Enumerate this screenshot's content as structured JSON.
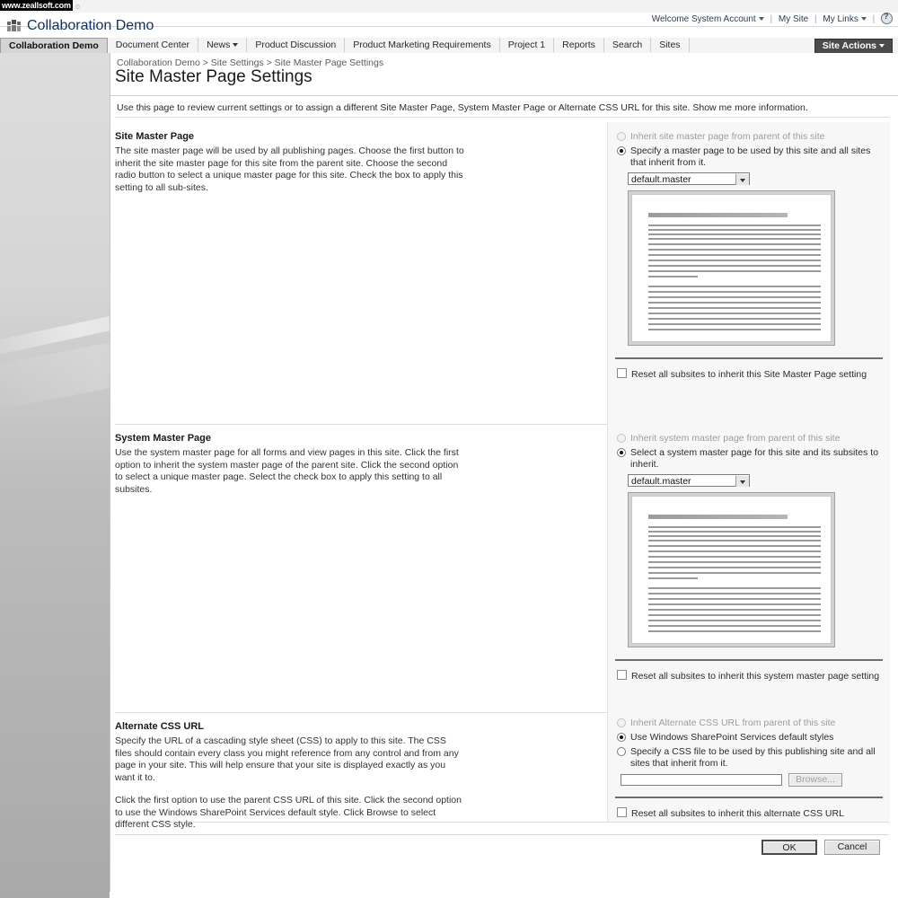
{
  "watermark": {
    "text": "www.zeallsoft.com",
    "shadow": "o"
  },
  "globalbar": {
    "welcome": "Welcome System Account",
    "my_site": "My Site",
    "my_links": "My Links",
    "help_icon": "help-icon",
    "separator": "|"
  },
  "site": {
    "logo_icon": "people-group-icon",
    "title": "Collaboration Demo"
  },
  "tabs": [
    {
      "label": "Collaboration Demo",
      "selected": true,
      "dropdown": false
    },
    {
      "label": "Document Center",
      "selected": false,
      "dropdown": false
    },
    {
      "label": "News",
      "selected": false,
      "dropdown": true
    },
    {
      "label": "Product Discussion",
      "selected": false,
      "dropdown": false
    },
    {
      "label": "Product Marketing Requirements",
      "selected": false,
      "dropdown": false
    },
    {
      "label": "Project 1",
      "selected": false,
      "dropdown": false
    },
    {
      "label": "Reports",
      "selected": false,
      "dropdown": false
    },
    {
      "label": "Search",
      "selected": false,
      "dropdown": false
    },
    {
      "label": "Sites",
      "selected": false,
      "dropdown": false
    }
  ],
  "site_actions": {
    "label": "Site Actions"
  },
  "page": {
    "breadcrumb": "Collaboration Demo > Site Settings > Site Master Page Settings",
    "title": "Site Master Page Settings",
    "description": "Use this page to review current settings or to assign a different Site Master Page, System Master Page or Alternate CSS URL for this site. Show me more information."
  },
  "site_master_page": {
    "heading": "Site Master Page",
    "body": "The site master page will be used by all publishing pages. Choose the first button to inherit the site master page for this site from the parent site. Choose the second radio button to select a unique master page for this site. Check the box to apply this setting to all sub-sites.",
    "option_inherit": "Inherit site master page from parent of this site",
    "option_specify": "Specify a master page to be used by this site and all sites that inherit from it.",
    "selected_master": "default.master",
    "reset_label": "Reset all subsites to inherit this Site Master Page setting",
    "reset_checked": false,
    "inherit_enabled": false,
    "specify_selected": true
  },
  "system_master_page": {
    "heading": "System Master Page",
    "body": "Use the system master page for all forms and view pages in this site. Click the first option to inherit the system master page of the parent site. Click the second option to select a unique master page. Select the check box to apply this setting to all subsites.",
    "option_inherit": "Inherit system master page from parent of this site",
    "option_select": "Select a system master page for this site and its subsites to inherit.",
    "selected_master": "default.master",
    "reset_label": "Reset all subsites to inherit this system master page setting",
    "reset_checked": false,
    "inherit_enabled": false,
    "select_selected": true
  },
  "alternate_css": {
    "heading": "Alternate CSS URL",
    "body_1": "Specify the URL of a cascading style sheet (CSS) to apply to this site. The CSS files should contain every class you might reference from any control and from any page in your site. This will help ensure that your site is displayed exactly as you want it to.",
    "body_2": "Click the first option to use the parent CSS URL of this site. Click the second option to use the Windows SharePoint Services default style. Click Browse to select different CSS style.",
    "option_inherit": "Inherit Alternate CSS URL from parent of this site",
    "option_default": "Use Windows SharePoint Services default styles",
    "option_specify": "Specify a CSS file to be used by this publishing site and all sites that inherit from it.",
    "css_url_value": "",
    "css_url_placeholder": "",
    "browse_label": "Browse...",
    "browse_enabled": false,
    "reset_label": "Reset all subsites to inherit this alternate CSS URL",
    "reset_checked": false,
    "inherit_enabled": false,
    "default_selected": true
  },
  "actions": {
    "ok_label": "OK",
    "cancel_label": "Cancel"
  },
  "colors": {
    "title_blue": "#12305c",
    "site_actions_bg": "#4b4b4b",
    "tab_selected_bg": "#d4d4d4",
    "panel_bg": "#f7f7f7"
  }
}
